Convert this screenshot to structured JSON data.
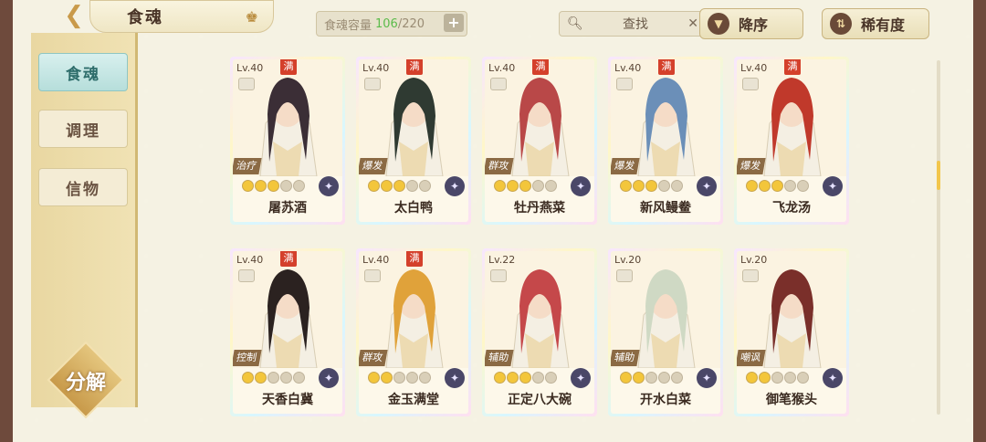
{
  "header": {
    "back_icon": "back-arrow-icon",
    "title": "食魂",
    "capacity": {
      "label": "食魂容量",
      "current": "106",
      "max": "/220"
    },
    "search": {
      "placeholder": "查找"
    },
    "sort_order": "降序",
    "sort_rarity": "稀有度"
  },
  "sidebar": {
    "items": [
      {
        "label": "食魂",
        "active": true
      },
      {
        "label": "调理",
        "active": false
      },
      {
        "label": "信物",
        "active": false
      }
    ],
    "decompose": "分解"
  },
  "colors": {
    "accent": "#f3c63b",
    "active_tab": "#b6dedb",
    "max_badge": "#d4402b"
  },
  "cards": [
    {
      "level": "Lv.40",
      "max": "满",
      "role": "治疗",
      "stars_on": 3,
      "name": "屠苏酒",
      "hue": "#3b2e36"
    },
    {
      "level": "Lv.40",
      "max": "满",
      "role": "爆发",
      "stars_on": 3,
      "name": "太白鸭",
      "hue": "#2f3a32"
    },
    {
      "level": "Lv.40",
      "max": "满",
      "role": "群攻",
      "stars_on": 3,
      "name": "牡丹燕菜",
      "hue": "#b94848"
    },
    {
      "level": "Lv.40",
      "max": "满",
      "role": "爆发",
      "stars_on": 3,
      "name": "新风鳗鲞",
      "hue": "#6b8fb8"
    },
    {
      "level": "Lv.40",
      "max": "满",
      "role": "爆发",
      "stars_on": 3,
      "name": "飞龙汤",
      "hue": "#c0392b"
    },
    {
      "level": "Lv.40",
      "max": "满",
      "role": "控制",
      "stars_on": 2,
      "name": "天香白冀",
      "hue": "#2b2220"
    },
    {
      "level": "Lv.40",
      "max": "满",
      "role": "群攻",
      "stars_on": 2,
      "name": "金玉满堂",
      "hue": "#e0a23a"
    },
    {
      "level": "Lv.22",
      "max": "",
      "role": "辅助",
      "stars_on": 3,
      "name": "正定八大碗",
      "hue": "#c5484a"
    },
    {
      "level": "Lv.20",
      "max": "",
      "role": "辅助",
      "stars_on": 2,
      "name": "开水白菜",
      "hue": "#cfd9c4"
    },
    {
      "level": "Lv.20",
      "max": "",
      "role": "嘲讽",
      "stars_on": 2,
      "name": "御笔猴头",
      "hue": "#7a2f2a"
    }
  ]
}
